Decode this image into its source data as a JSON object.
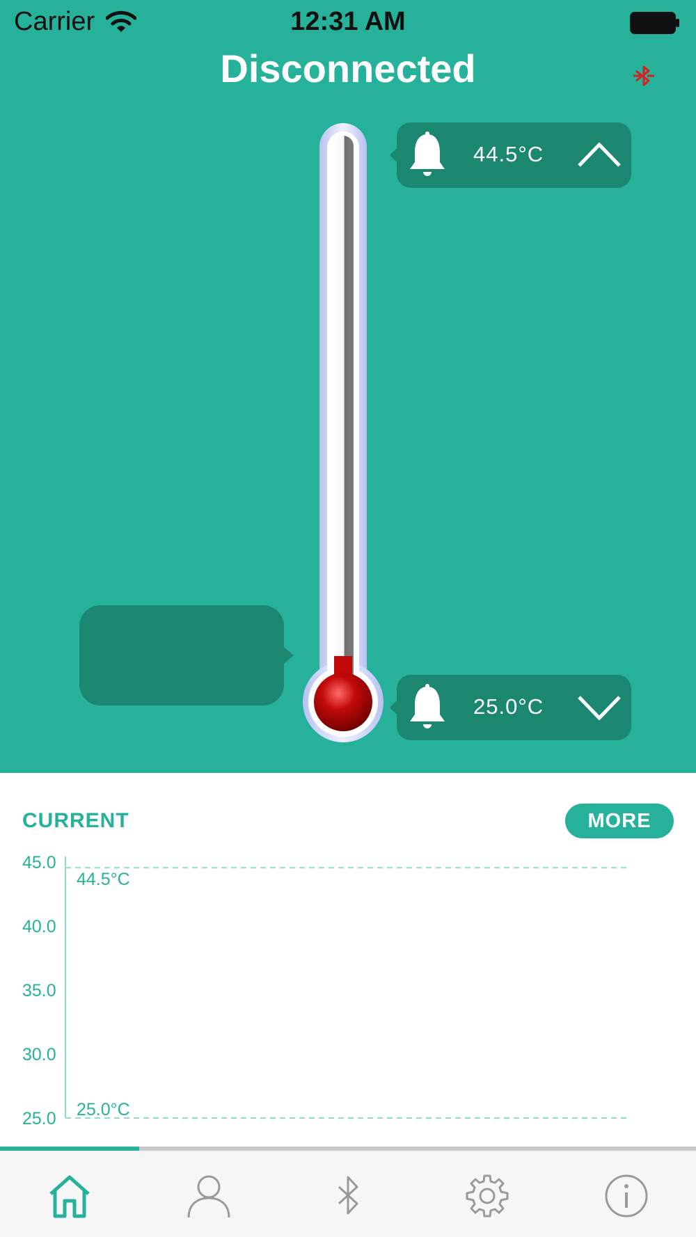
{
  "status_bar": {
    "carrier": "Carrier",
    "time": "12:31 AM"
  },
  "header": {
    "title": "Disconnected"
  },
  "alarms": {
    "high": {
      "value": "44.5°C",
      "icon": "bell-icon",
      "arrow_icon": "chevron-up-icon"
    },
    "low": {
      "value": "25.0°C",
      "icon": "bell-icon",
      "arrow_icon": "chevron-down-icon"
    }
  },
  "current_reading": "",
  "section": {
    "label": "CURRENT",
    "more_label": "MORE"
  },
  "chart_data": {
    "type": "line",
    "title": "",
    "xlabel": "",
    "ylabel": "",
    "ylim": [
      25.0,
      45.0
    ],
    "yticks": [
      "45.0",
      "40.0",
      "35.0",
      "30.0",
      "25.0"
    ],
    "series": [],
    "annotations": [
      {
        "label": "44.5°C",
        "y": 44.5,
        "style": "dashed"
      },
      {
        "label": "25.0°C",
        "y": 25.0,
        "style": "dashed"
      }
    ],
    "grid": false
  },
  "tabs": [
    {
      "name": "home",
      "icon": "home-icon",
      "active": true
    },
    {
      "name": "user",
      "icon": "user-icon",
      "active": false
    },
    {
      "name": "bluetooth",
      "icon": "bluetooth-icon",
      "active": false
    },
    {
      "name": "settings",
      "icon": "gear-icon",
      "active": false
    },
    {
      "name": "info",
      "icon": "info-icon",
      "active": false
    }
  ],
  "colors": {
    "accent": "#26b29a",
    "dark_accent": "#1c8770",
    "alert": "#d32020",
    "inactive": "#9a9a9a"
  }
}
